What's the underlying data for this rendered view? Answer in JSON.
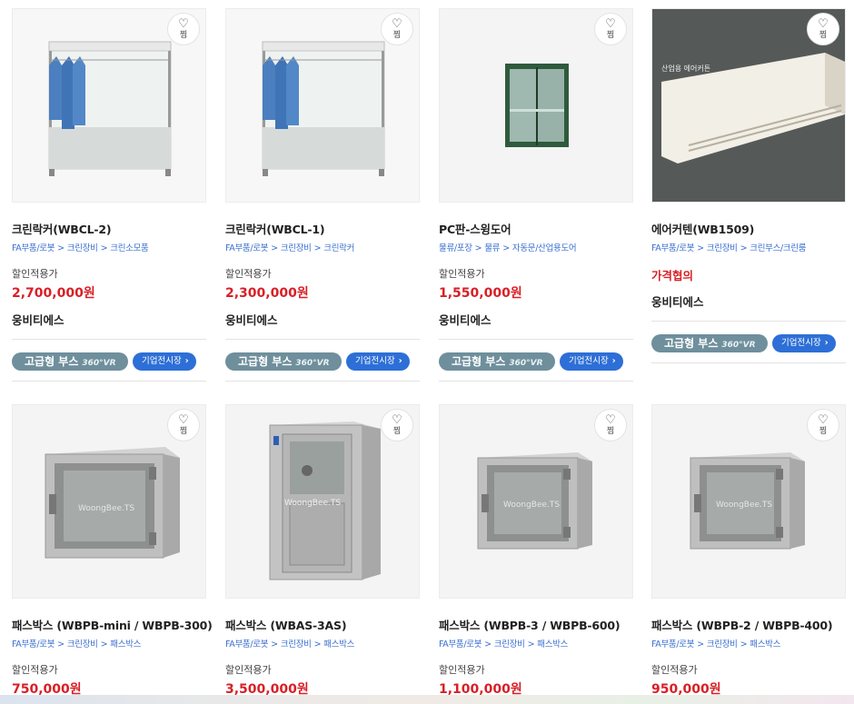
{
  "wish_label": "찜",
  "discount_label": "할인적용가",
  "booth_label": "고급형 부스",
  "booth_vr": "360°VR",
  "expo_label": "기업전시장",
  "colors": {
    "price": "#d91f26",
    "category": "#3a6fcf",
    "booth": "#6f8f9c",
    "expo": "#2d6fd6"
  },
  "products": [
    {
      "title": "크린락커(WBCL-2)",
      "category": [
        "FA부품/로봇",
        "크린장비",
        "크린소모품"
      ],
      "price": "2,700,000원",
      "seller": "웅비티에스",
      "image": "clean-locker"
    },
    {
      "title": "크린락커(WBCL-1)",
      "category": [
        "FA부품/로봇",
        "크린장비",
        "크린락커"
      ],
      "price": "2,300,000원",
      "seller": "웅비티에스",
      "image": "clean-locker"
    },
    {
      "title": "PC판-스윙도어",
      "category": [
        "물류/포장",
        "물류",
        "자동문/산업용도어"
      ],
      "price": "1,550,000원",
      "seller": "웅비티에스",
      "image": "swing-door"
    },
    {
      "title": "에어커텐(WB1509)",
      "category": [
        "FA부품/로봇",
        "크린장비",
        "크린부스/크린룸"
      ],
      "price": "가격협의",
      "seller": "웅비티에스",
      "image": "air-curtain",
      "inquiry": true,
      "image_caption": "산업용 에어커튼"
    },
    {
      "title": "패스박스 (WBPB-mini / WBPB-300)",
      "category": [
        "FA부품/로봇",
        "크린장비",
        "패스박스"
      ],
      "price": "750,000원",
      "image": "pass-box",
      "image_caption": "WoongBee.TS"
    },
    {
      "title": "패스박스 (WBAS-3AS)",
      "category": [
        "FA부품/로봇",
        "크린장비",
        "패스박스"
      ],
      "price": "3,500,000원",
      "image": "air-shower",
      "image_caption": "WoongBee.TS"
    },
    {
      "title": "패스박스 (WBPB-3 / WBPB-600)",
      "category": [
        "FA부품/로봇",
        "크린장비",
        "패스박스"
      ],
      "price": "1,100,000원",
      "image": "pass-box",
      "image_caption": "WoongBee.TS"
    },
    {
      "title": "패스박스 (WBPB-2 / WBPB-400)",
      "category": [
        "FA부품/로봇",
        "크린장비",
        "패스박스"
      ],
      "price": "950,000원",
      "image": "pass-box",
      "image_caption": "WoongBee.TS"
    }
  ]
}
